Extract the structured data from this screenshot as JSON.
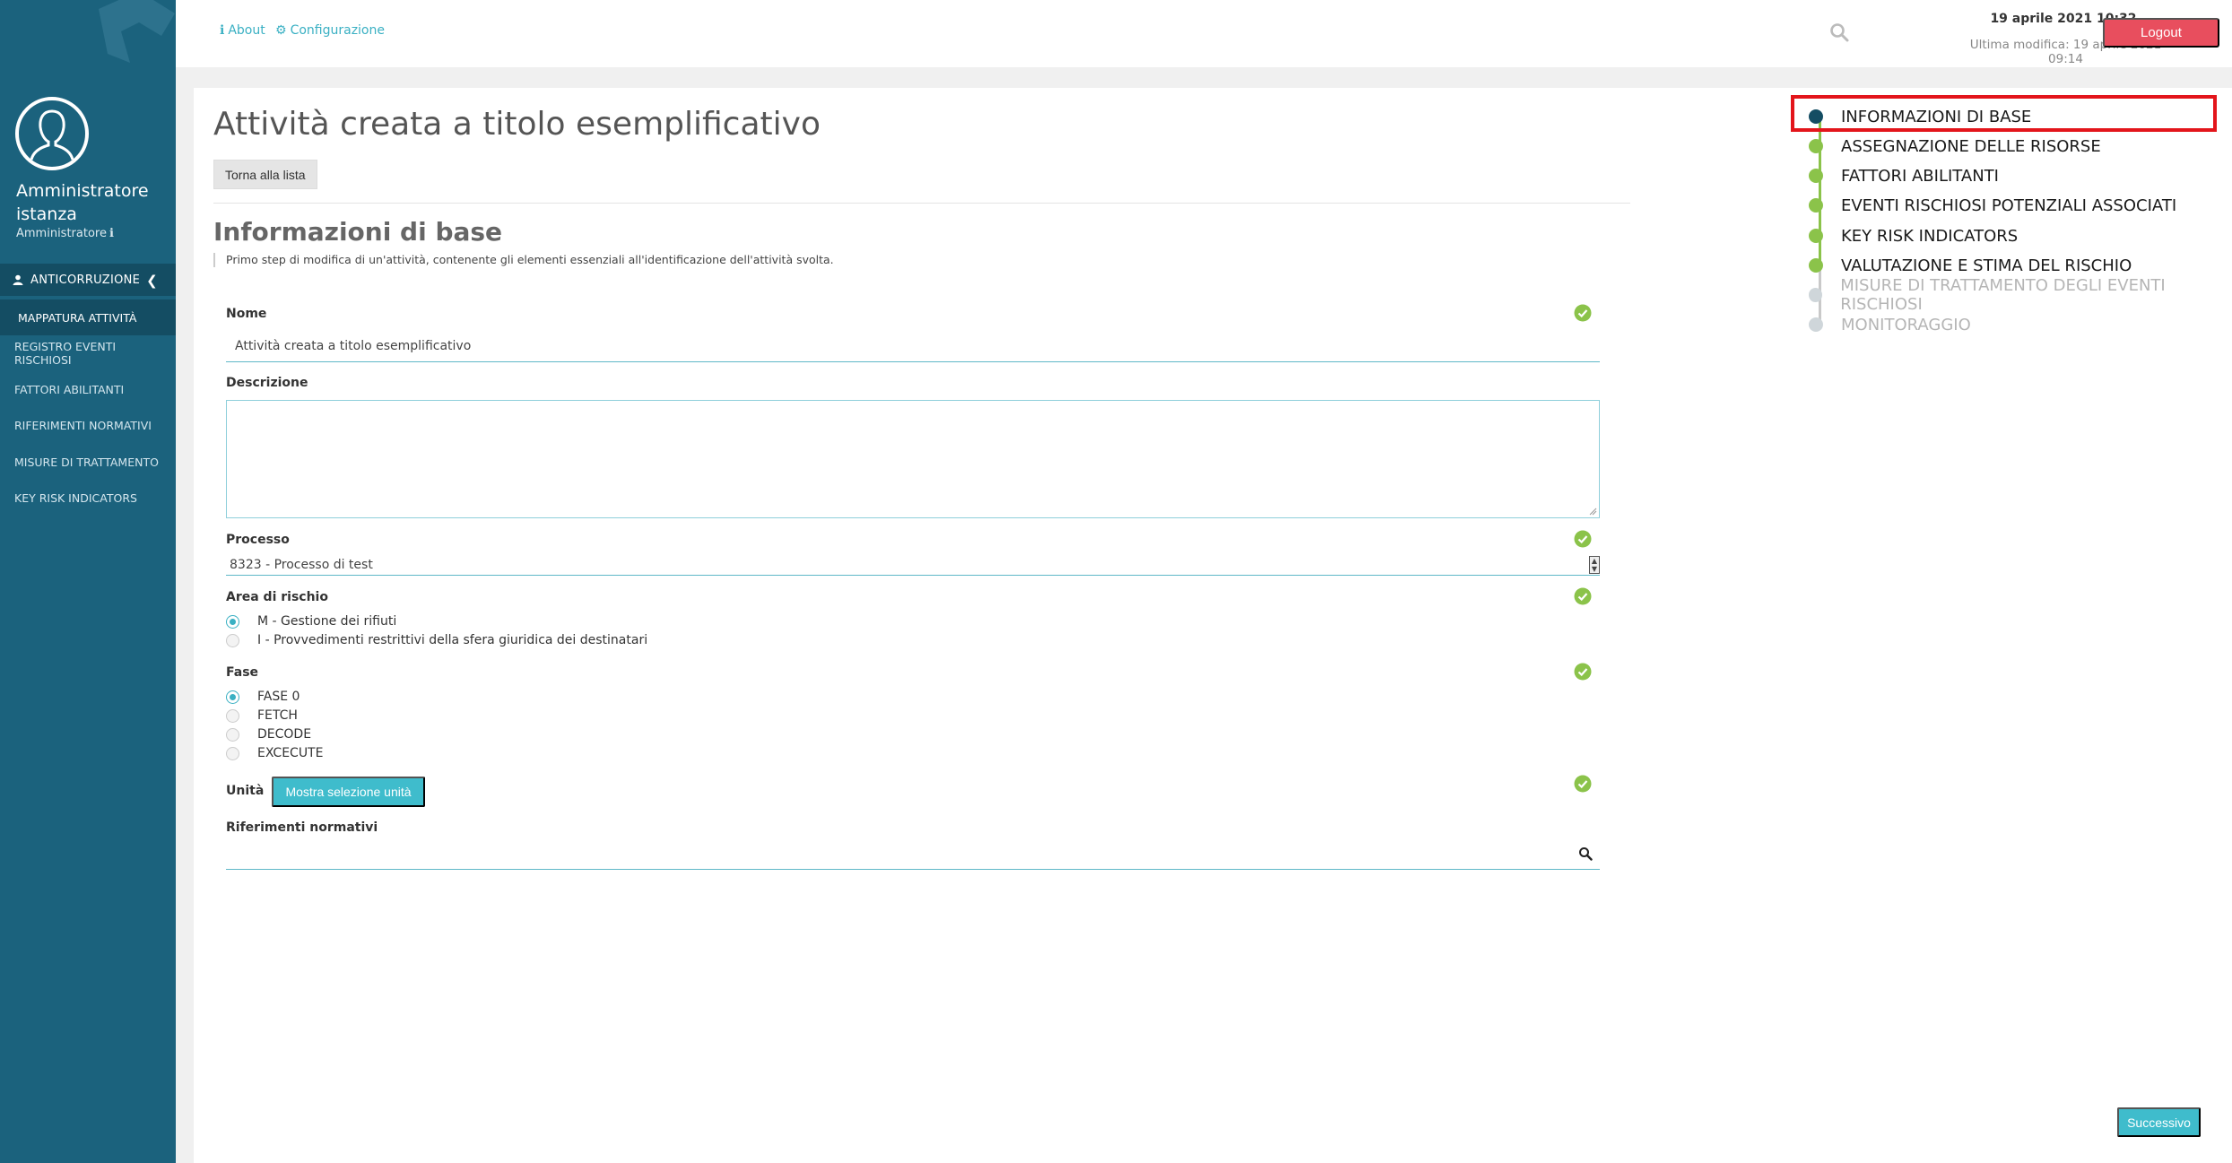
{
  "sidebar": {
    "user_name": "Amministratore istanza",
    "user_role": "Amministratore",
    "menu_header": "ANTICORRUZIONE",
    "items": [
      {
        "label": "MAPPATURA ATTIVITÀ",
        "active": true
      },
      {
        "label": "REGISTRO EVENTI RISCHIOSI",
        "active": false
      },
      {
        "label": "FATTORI ABILITANTI",
        "active": false
      },
      {
        "label": "RIFERIMENTI NORMATIVI",
        "active": false
      },
      {
        "label": "MISURE DI TRATTAMENTO",
        "active": false
      },
      {
        "label": "KEY RISK INDICATORS",
        "active": false
      }
    ]
  },
  "topbar": {
    "about_label": "About",
    "config_label": "Configurazione",
    "date_now": "19 aprile 2021 10:32",
    "last_modified": "Ultima modifica: 19 aprile 2021 09:14",
    "logout_label": "Logout"
  },
  "page": {
    "title": "Attività creata a titolo esemplificativo",
    "back_button": "Torna alla lista",
    "section_title": "Informazioni di base",
    "section_desc": "Primo step di modifica di un'attività, contenente gli elementi essenziali all'identificazione dell'attività svolta."
  },
  "form": {
    "name_label": "Nome",
    "name_value": "Attività creata a titolo esemplificativo",
    "description_label": "Descrizione",
    "description_value": "",
    "process_label": "Processo",
    "process_value": "8323 - Processo di test",
    "risk_area_label": "Area di rischio",
    "risk_area_options": [
      {
        "label": "M - Gestione dei rifiuti",
        "selected": true
      },
      {
        "label": "I - Provvedimenti restrittivi della sfera giuridica dei destinatari",
        "selected": false
      }
    ],
    "phase_label": "Fase",
    "phase_options": [
      {
        "label": "FASE 0",
        "selected": true
      },
      {
        "label": "FETCH",
        "selected": false
      },
      {
        "label": "DECODE",
        "selected": false
      },
      {
        "label": "EXCECUTE",
        "selected": false
      }
    ],
    "unit_label": "Unità",
    "unit_button": "Mostra selezione unità",
    "references_label": "Riferimenti normativi",
    "next_button": "Successivo"
  },
  "stepper": {
    "steps": [
      {
        "label": "INFORMAZIONI DI BASE",
        "state": "current"
      },
      {
        "label": "ASSEGNAZIONE DELLE RISORSE",
        "state": "done"
      },
      {
        "label": "FATTORI ABILITANTI",
        "state": "done"
      },
      {
        "label": "EVENTI RISCHIOSI POTENZIALI ASSOCIATI",
        "state": "done"
      },
      {
        "label": "KEY RISK INDICATORS",
        "state": "done"
      },
      {
        "label": "VALUTAZIONE E STIMA DEL RISCHIO",
        "state": "done"
      },
      {
        "label": "MISURE DI TRATTAMENTO DEGLI EVENTI RISCHIOSI",
        "state": "todo"
      },
      {
        "label": "MONITORAGGIO",
        "state": "todo"
      }
    ]
  },
  "colors": {
    "sidebar": "#1b627d",
    "accent": "#3ab0c3",
    "logout": "#e84e5e",
    "done": "#8bc34a",
    "highlight": "#e3151b"
  }
}
